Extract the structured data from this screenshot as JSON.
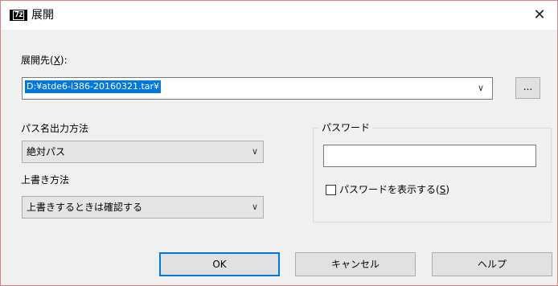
{
  "window": {
    "title": "展開",
    "icon_text": "7z",
    "close_glyph": "✕"
  },
  "extract_to": {
    "label": "展開先(",
    "mnemonic": "X",
    "label_end": "):",
    "value": "D:¥atde6-i386-20160321.tar¥",
    "browse_label": "..."
  },
  "path_mode": {
    "label": "パス名出力方法",
    "selected": "絶対パス"
  },
  "overwrite_mode": {
    "label": "上書き方法",
    "selected": "上書きするときは確認する"
  },
  "password": {
    "group_title": "パスワード",
    "value": "",
    "show_label": "パスワードを表示する(",
    "show_mnemonic": "S",
    "show_label_end": ")",
    "show_checked": false
  },
  "buttons": {
    "ok": "OK",
    "cancel": "キャンセル",
    "help": "ヘルプ"
  },
  "icons": {
    "chevron": "∨"
  }
}
